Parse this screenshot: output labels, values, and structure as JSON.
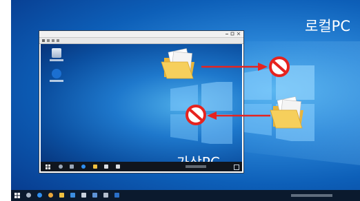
{
  "host": {
    "label": "로컬PC",
    "taskbar_clock": "",
    "colors": {
      "desktop_center": "#56b4f0",
      "desktop_edge": "#07388a",
      "taskbar": "#0b1a2e"
    }
  },
  "vm": {
    "window_title": "",
    "label": "가상PC",
    "colors": {
      "titlebar": "#f1f1f1",
      "taskbar": "#10151d"
    }
  },
  "icons": {
    "folder": "folder-icon",
    "blocked": "no-entry-icon",
    "arrow": "arrow-icon",
    "recycle_bin": "recycle-bin-icon",
    "edge": "edge-browser-icon"
  },
  "annotations": {
    "arrow_color": "#e6231f",
    "blocked_color": "#e6231f"
  }
}
